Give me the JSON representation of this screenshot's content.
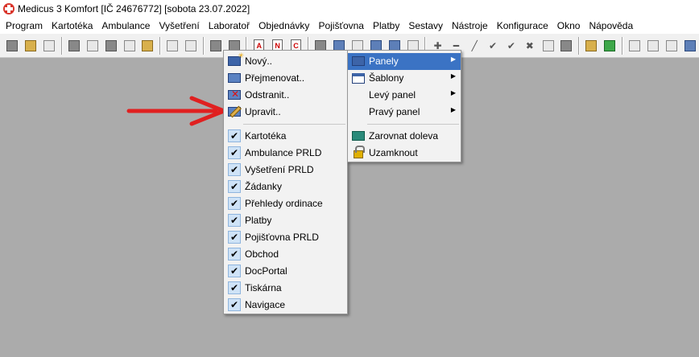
{
  "window": {
    "title": "Medicus 3 Komfort  [IČ 24676772]  [sobota 23.07.2022]"
  },
  "menubar": [
    "Program",
    "Kartotéka",
    "Ambulance",
    "Vyšetření",
    "Laboratoř",
    "Objednávky",
    "Pojišťovna",
    "Platby",
    "Sestavy",
    "Nástroje",
    "Konfigurace",
    "Okno",
    "Nápověda"
  ],
  "toolbar": {
    "doc_a": "A",
    "doc_n": "N",
    "doc_c": "C"
  },
  "context_menu": {
    "actions": [
      "Nový..",
      "Přejmenovat..",
      "Odstranit..",
      "Upravit.."
    ],
    "panels": [
      "Kartotéka",
      "Ambulance PRLD",
      "Vyšetření PRLD",
      "Žádanky",
      "Přehledy ordinace",
      "Platby",
      "Pojišťovna PRLD",
      "Obchod",
      "DocPortal",
      "Tiskárna",
      "Navigace"
    ],
    "check_mark": "✔"
  },
  "submenu": {
    "items": [
      "Panely",
      "Šablony",
      "Levý panel",
      "Pravý panel"
    ],
    "actions": [
      "Zarovnat doleva",
      "Uzamknout"
    ],
    "arrow": "▶"
  },
  "colors": {
    "highlight": "#3b73c4",
    "workspace": "#ababab",
    "annotation_arrow": "#e02020"
  }
}
